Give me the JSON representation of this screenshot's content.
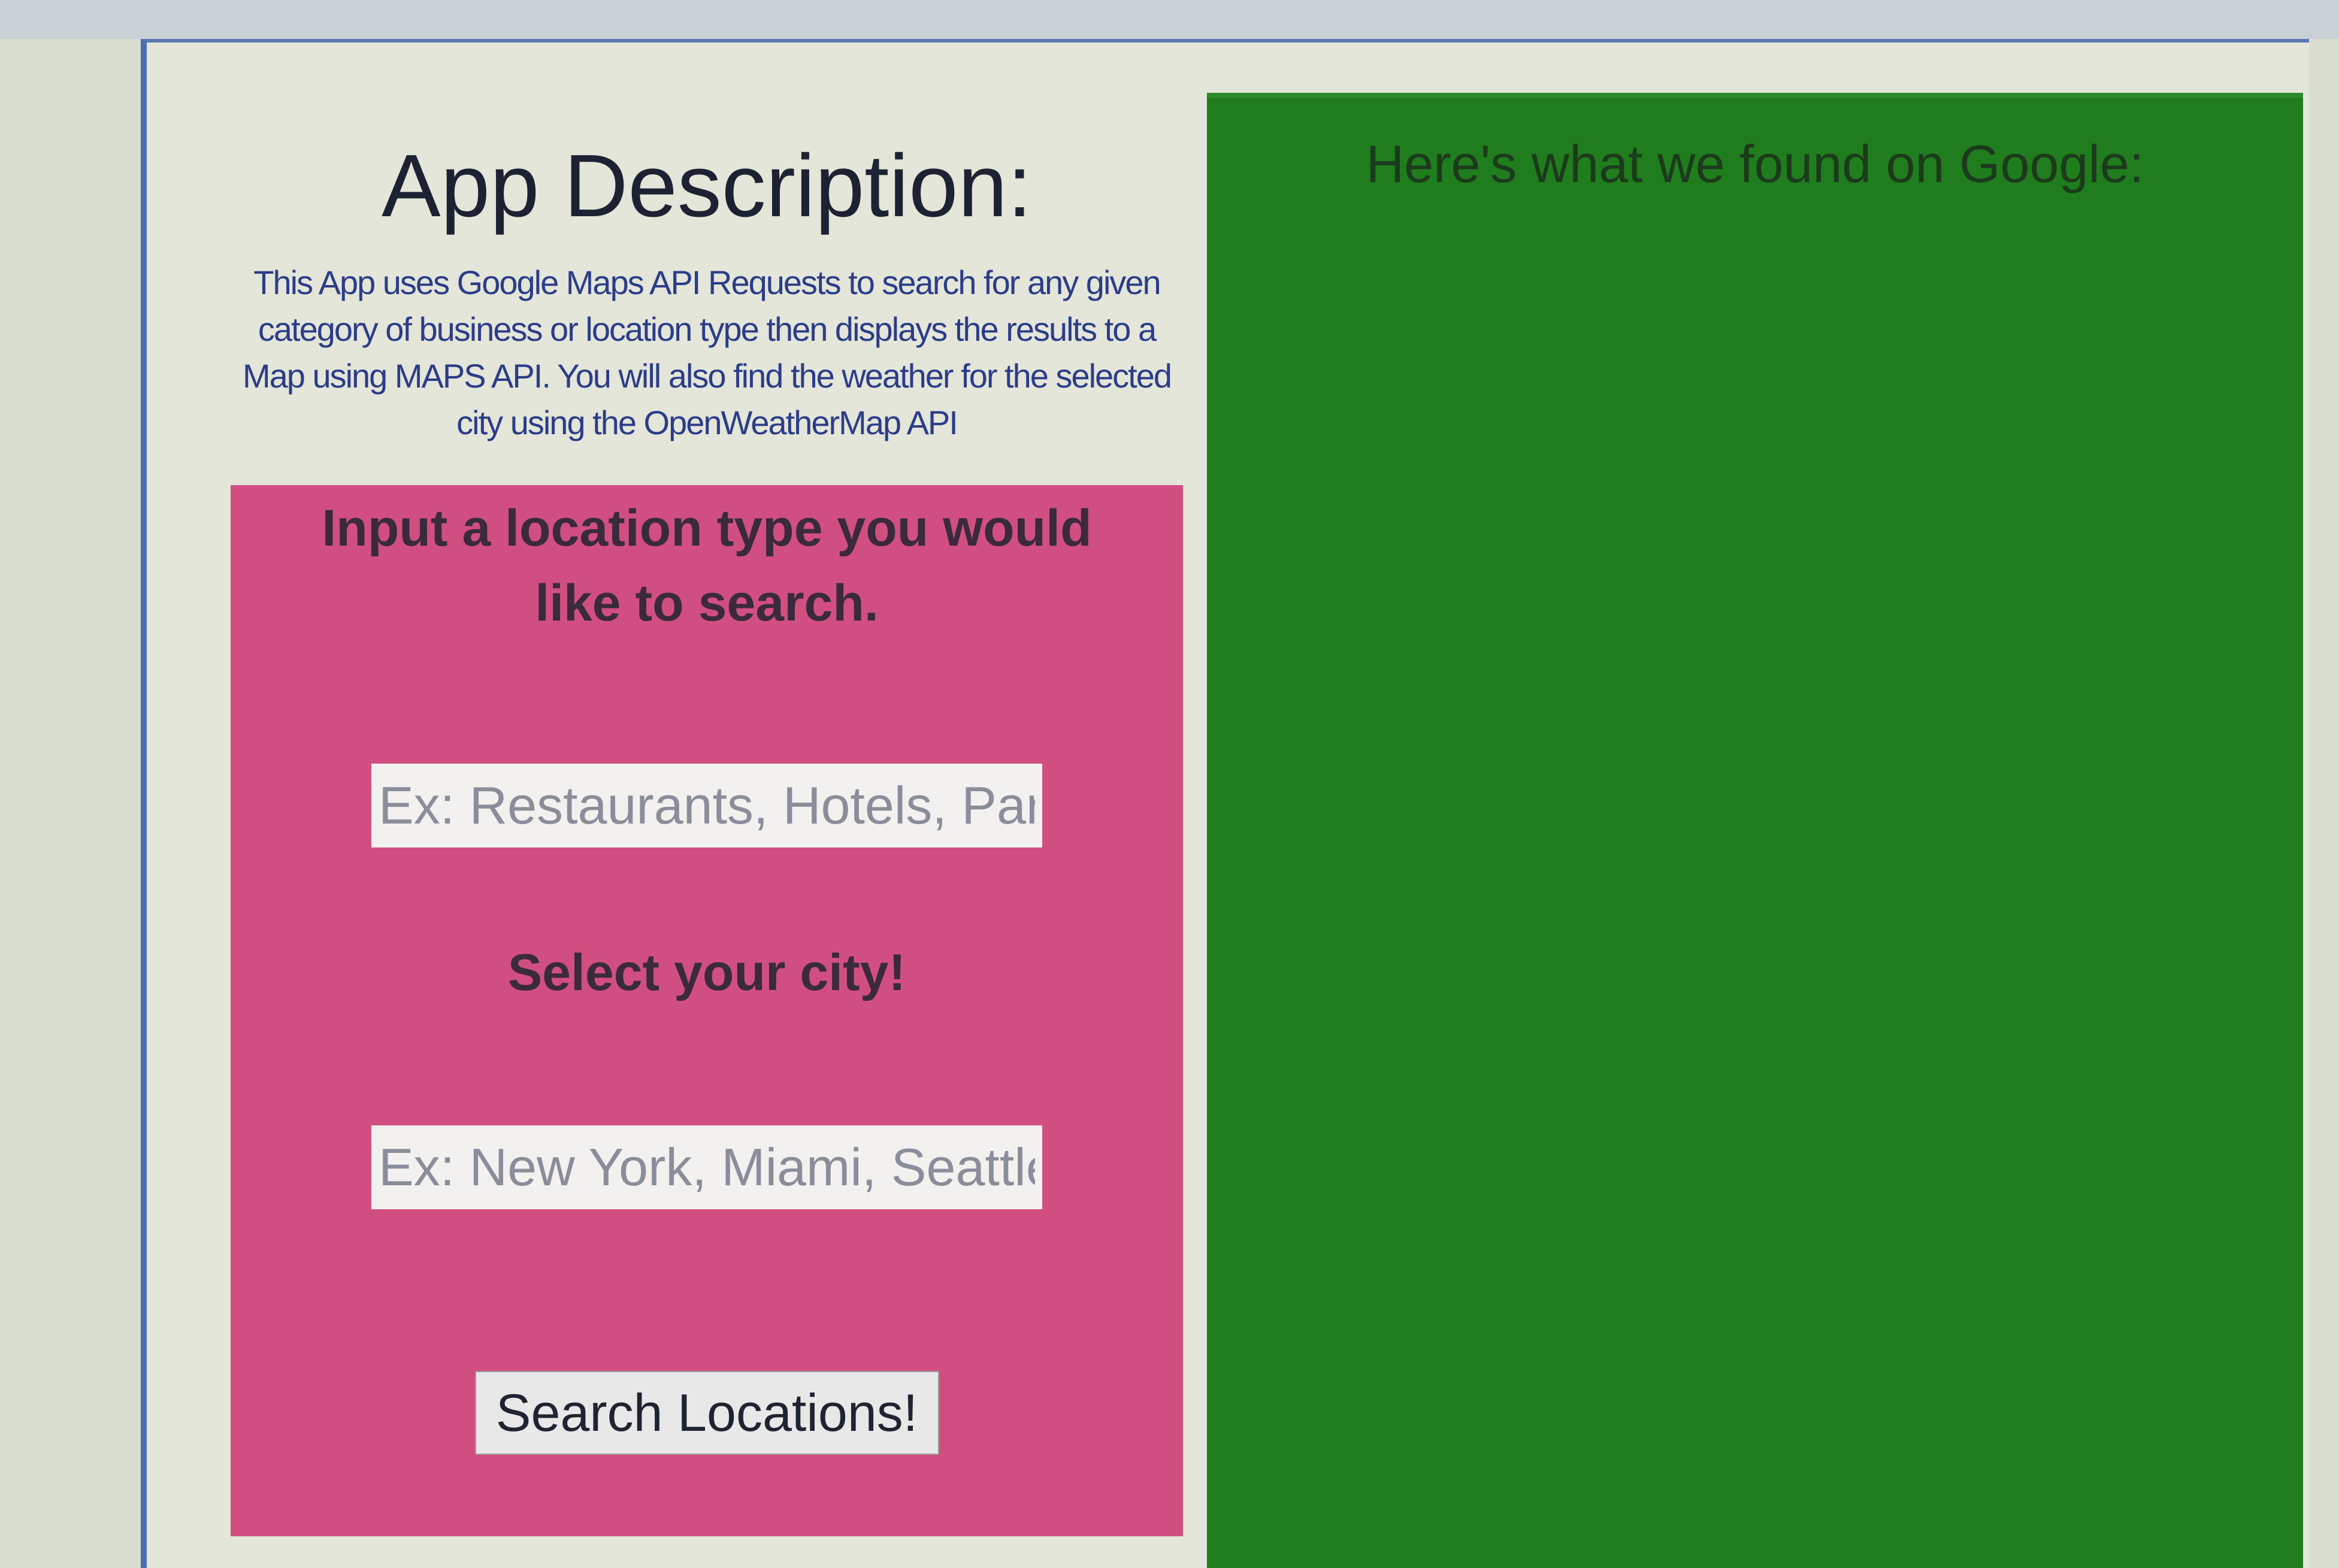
{
  "left": {
    "title": "App Description:",
    "description": "This App uses Google Maps API Requests to search for any given category of business or location type then displays the results to a Map using MAPS API. You will also find the weather for the selected city using the OpenWeatherMap API"
  },
  "search": {
    "heading": "Input a location type you would like to search.",
    "location_placeholder": "Ex: Restaurants, Hotels, Parks",
    "city_label": "Select your city!",
    "city_placeholder": "Ex: New York, Miami, Seattle",
    "button_label": "Search Locations!"
  },
  "results": {
    "heading": "Here's what we found on Google:"
  },
  "colors": {
    "search_panel": "#d14f80",
    "results_panel": "#1f7d1d",
    "page_background": "#e3e6d8"
  }
}
